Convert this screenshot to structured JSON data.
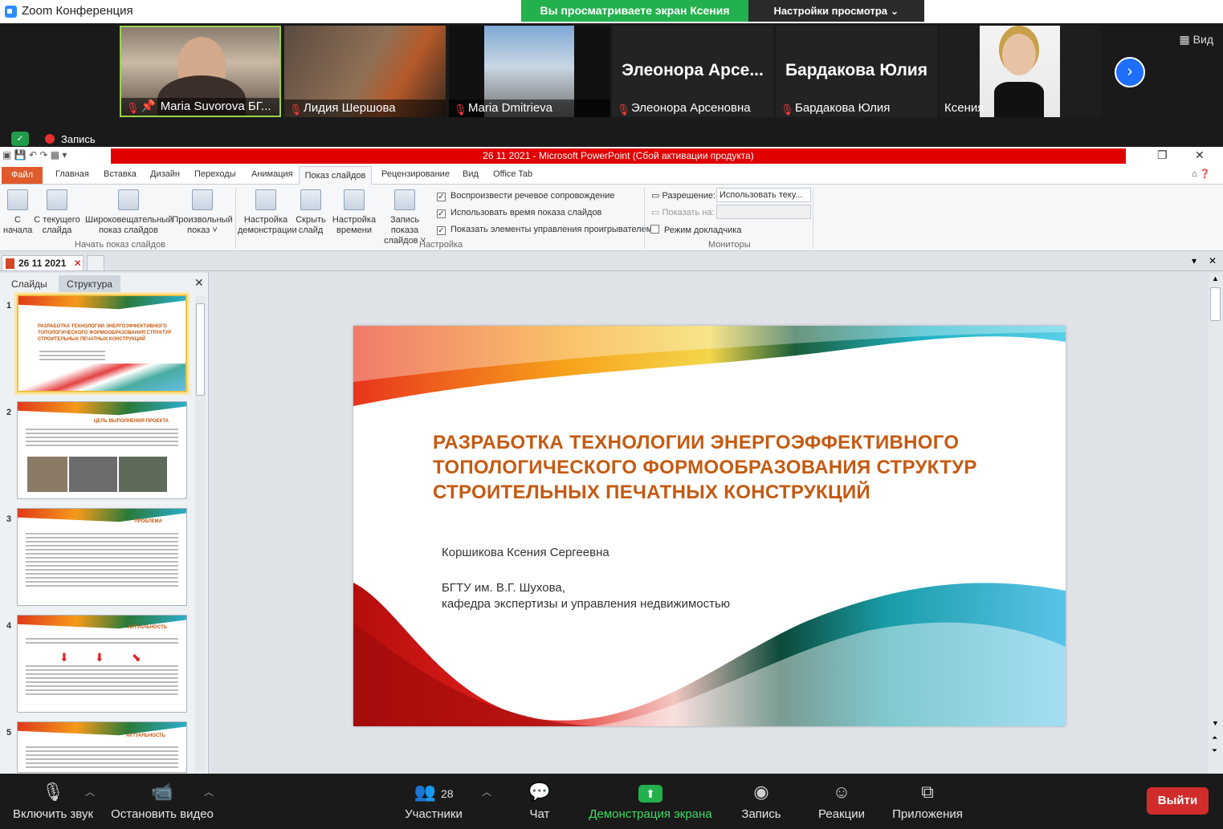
{
  "zoom": {
    "window_title": "Zoom Конференция",
    "share_banner": "Вы просматриваете экран Ксения",
    "view_settings": "Настройки просмотра",
    "view_button": "Вид",
    "recording_label": "Запись",
    "participants": [
      {
        "name": "Maria Suvorova БГ...",
        "type": "video"
      },
      {
        "name": "Лидия Шершова",
        "type": "video"
      },
      {
        "name": "Maria Dmitrieva",
        "type": "video"
      },
      {
        "name": "Элеонора Арсеновна",
        "display": "Элеонора Арсе...",
        "type": "name"
      },
      {
        "name": "Бардакова Юлия",
        "display": "Бардакова Юлия",
        "type": "name"
      },
      {
        "name": "Ксения",
        "type": "video"
      }
    ],
    "toolbar": {
      "unmute": "Включить звук",
      "stop_video": "Остановить видео",
      "participants_label": "Участники",
      "participants_count": "28",
      "chat": "Чат",
      "share_screen": "Демонстрация экрана",
      "record": "Запись",
      "reactions": "Реакции",
      "apps": "Приложения",
      "exit": "Выйти"
    }
  },
  "powerpoint": {
    "title": "26 11 2021  -  Microsoft PowerPoint (Сбой активации продукта)",
    "menu": {
      "file": "Файл",
      "tabs": [
        "Главная",
        "Вставка",
        "Дизайн",
        "Переходы",
        "Анимация",
        "Показ слайдов",
        "Рецензирование",
        "Вид",
        "Office Tab"
      ]
    },
    "ribbon": {
      "from_start": [
        "С",
        "начала"
      ],
      "from_current": [
        "С текущего",
        "слайда"
      ],
      "broadcast": [
        "Широковещательный",
        "показ слайдов"
      ],
      "custom": [
        "Произвольный",
        "показ ˅"
      ],
      "group_start": "Начать показ слайдов",
      "setup": [
        "Настройка",
        "демонстрации"
      ],
      "hide": [
        "Скрыть",
        "слайд"
      ],
      "rehearse": [
        "Настройка",
        "времени"
      ],
      "record": [
        "Запись показа",
        "слайдов ˅"
      ],
      "chk_narration": "Воспроизвести речевое сопровождение",
      "chk_timings": "Использовать время показа слайдов",
      "chk_controls": "Показать элементы управления проигрывателем",
      "group_setup": "Настройка",
      "resolution_label": "Разрешение:",
      "resolution_value": "Использовать теку...",
      "show_on_label": "Показать на:",
      "presenter_view": "Режим докладчика",
      "group_monitors": "Мониторы"
    },
    "doc_tab": "26 11 2021",
    "pane_tabs": [
      "Слайды",
      "Структура"
    ],
    "thumbs": [
      {
        "num": "1",
        "title": "РАЗРАБОТКА ТЕХНОЛОГИИ ЭНЕРГОЭФФЕКТИВНОГО ТОПОЛОГИЧЕСКОГО ФОРМООБРАЗОВАНИЯ СТРУКТУР СТРОИТЕЛЬНЫХ ПЕЧАТНЫХ КОНСТРУКЦИЙ"
      },
      {
        "num": "2",
        "title": "ЦЕЛЬ ВЫПОЛНЕНИЯ ПРОЕКТА"
      },
      {
        "num": "3",
        "title": "ПРОБЛЕМА"
      },
      {
        "num": "4",
        "title": "АКТУАЛЬНОСТЬ"
      },
      {
        "num": "5",
        "title": "АКТУАЛЬНОСТЬ"
      }
    ],
    "slide": {
      "title": "РАЗРАБОТКА ТЕХНОЛОГИИ ЭНЕРГОЭФФЕКТИВНОГО ТОПОЛОГИЧЕСКОГО ФОРМООБРАЗОВАНИЯ СТРУКТУР СТРОИТЕЛЬНЫХ ПЕЧАТНЫХ КОНСТРУКЦИЙ",
      "author": "Коршикова Ксения Сергеевна",
      "org_line1": "БГТУ им. В.Г. Шухова,",
      "org_line2": "кафедра экспертизы и управления недвижимостью"
    }
  }
}
